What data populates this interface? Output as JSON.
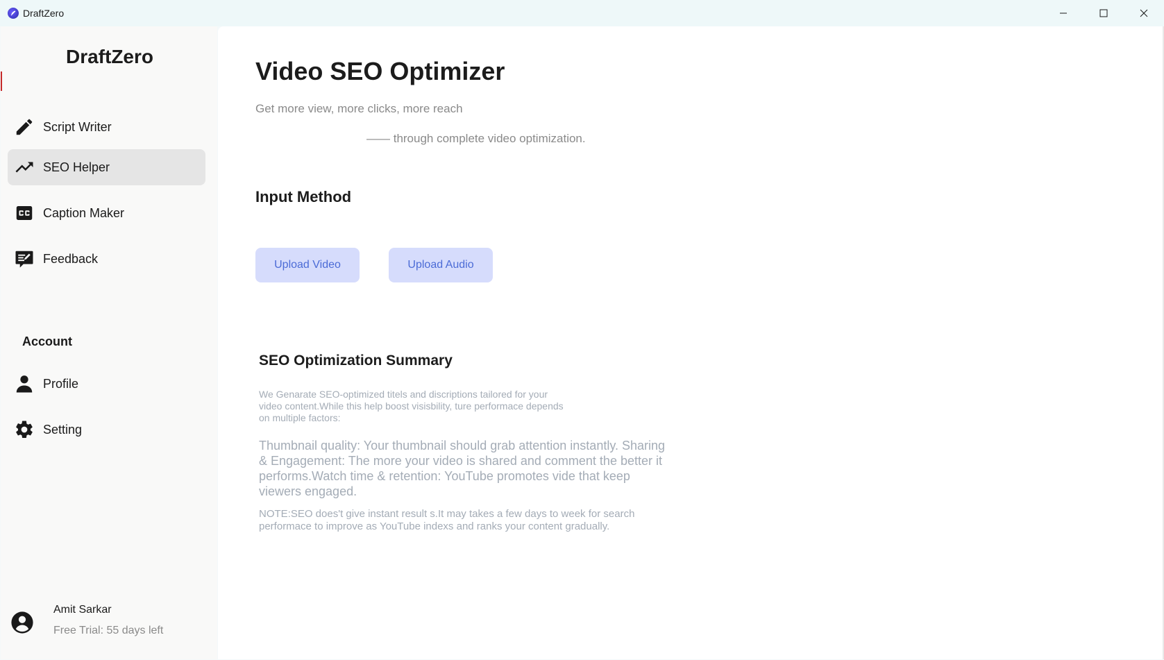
{
  "window": {
    "title": "DraftZero",
    "controls": [
      "minimize-icon",
      "maximize-icon",
      "close-icon"
    ]
  },
  "sidebar": {
    "brand": "DraftZero",
    "nav": [
      {
        "label": "Script Writer",
        "icon": "pencil-icon",
        "active": false
      },
      {
        "label": "SEO Helper",
        "icon": "trending-up-icon",
        "active": true
      },
      {
        "label": "Caption Maker",
        "icon": "closed-caption-icon",
        "active": false
      },
      {
        "label": "Feedback",
        "icon": "feedback-icon",
        "active": false
      }
    ],
    "account_label": "Account",
    "account": [
      {
        "label": "Profile",
        "icon": "person-icon"
      },
      {
        "label": "Setting",
        "icon": "gear-icon"
      }
    ],
    "user": {
      "name": "Amit Sarkar",
      "trial": "Free Trial: 55 days left"
    }
  },
  "main": {
    "title": "Video SEO Optimizer",
    "subtitle_line1": "Get more view, more clicks, more reach",
    "subtitle_line2": "—— through complete video optimization.",
    "input_method_heading": "Input Method",
    "buttons": {
      "upload_video": "Upload Video",
      "upload_audio": "Upload Audio"
    },
    "summary": {
      "heading": "SEO Optimization Summary",
      "intro": "We Genarate SEO-optimized titels and discriptions tailored for your video content.While this help boost visisbility, ture performace depends on multiple factors:",
      "body": "Thumbnail quality: Your thumbnail should grab attention instantly. Sharing & Engagement: The more your video is shared and comment the better it performs.Watch time & retention: YouTube promotes vide that keep viewers engaged.",
      "note": "NOTE:SEO does't give instant result s.It may takes a few days to week for search performace to improve as YouTube indexs and ranks your content gradually."
    }
  },
  "colors": {
    "active_nav_bg": "#e5e5e5",
    "button_bg": "#d6dcfc",
    "button_text": "#4b6bd6",
    "muted_text": "#a4acb6"
  }
}
